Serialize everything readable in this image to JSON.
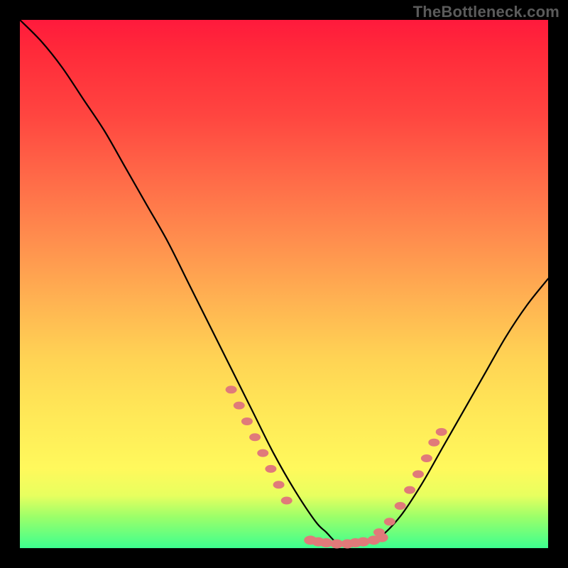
{
  "watermark": "TheBottleneck.com",
  "colors": {
    "background": "#000000",
    "gradient_top": "#ff1a3c",
    "gradient_bottom": "#3dff8f",
    "curve": "#000000",
    "markers": "#e07a7a"
  },
  "chart_data": {
    "type": "line",
    "title": "",
    "xlabel": "",
    "ylabel": "",
    "xlim": [
      0,
      100
    ],
    "ylim": [
      0,
      100
    ],
    "grid": false,
    "legends": [],
    "series": [
      {
        "name": "bottleneck-curve",
        "x": [
          0,
          4,
          8,
          12,
          16,
          20,
          24,
          28,
          32,
          36,
          40,
          44,
          48,
          52,
          56,
          58,
          60,
          62,
          64,
          68,
          72,
          76,
          80,
          84,
          88,
          92,
          96,
          100
        ],
        "values": [
          100,
          96,
          91,
          85,
          79,
          72,
          65,
          58,
          50,
          42,
          34,
          26,
          18,
          11,
          5,
          3,
          1,
          0.5,
          0.5,
          2,
          6,
          12,
          19,
          26,
          33,
          40,
          46,
          51
        ]
      },
      {
        "name": "near-bottom-markers-left",
        "type": "scatter",
        "x": [
          40,
          41.5,
          43,
          44.5,
          46,
          47.5,
          49,
          50.5
        ],
        "values": [
          30,
          27,
          24,
          21,
          18,
          15,
          12,
          9
        ]
      },
      {
        "name": "near-bottom-markers-right",
        "type": "scatter",
        "x": [
          68,
          70,
          72,
          73.8,
          75.4,
          77,
          78.4,
          79.8
        ],
        "values": [
          3,
          5,
          8,
          11,
          14,
          17,
          20,
          22
        ]
      },
      {
        "name": "bottom-flat-markers",
        "type": "scatter",
        "x": [
          55,
          56.5,
          58,
          60,
          62,
          63.5,
          65,
          67,
          68.5
        ],
        "values": [
          1.5,
          1.2,
          1,
          0.8,
          0.8,
          1,
          1.2,
          1.5,
          2
        ]
      }
    ],
    "annotations": []
  }
}
